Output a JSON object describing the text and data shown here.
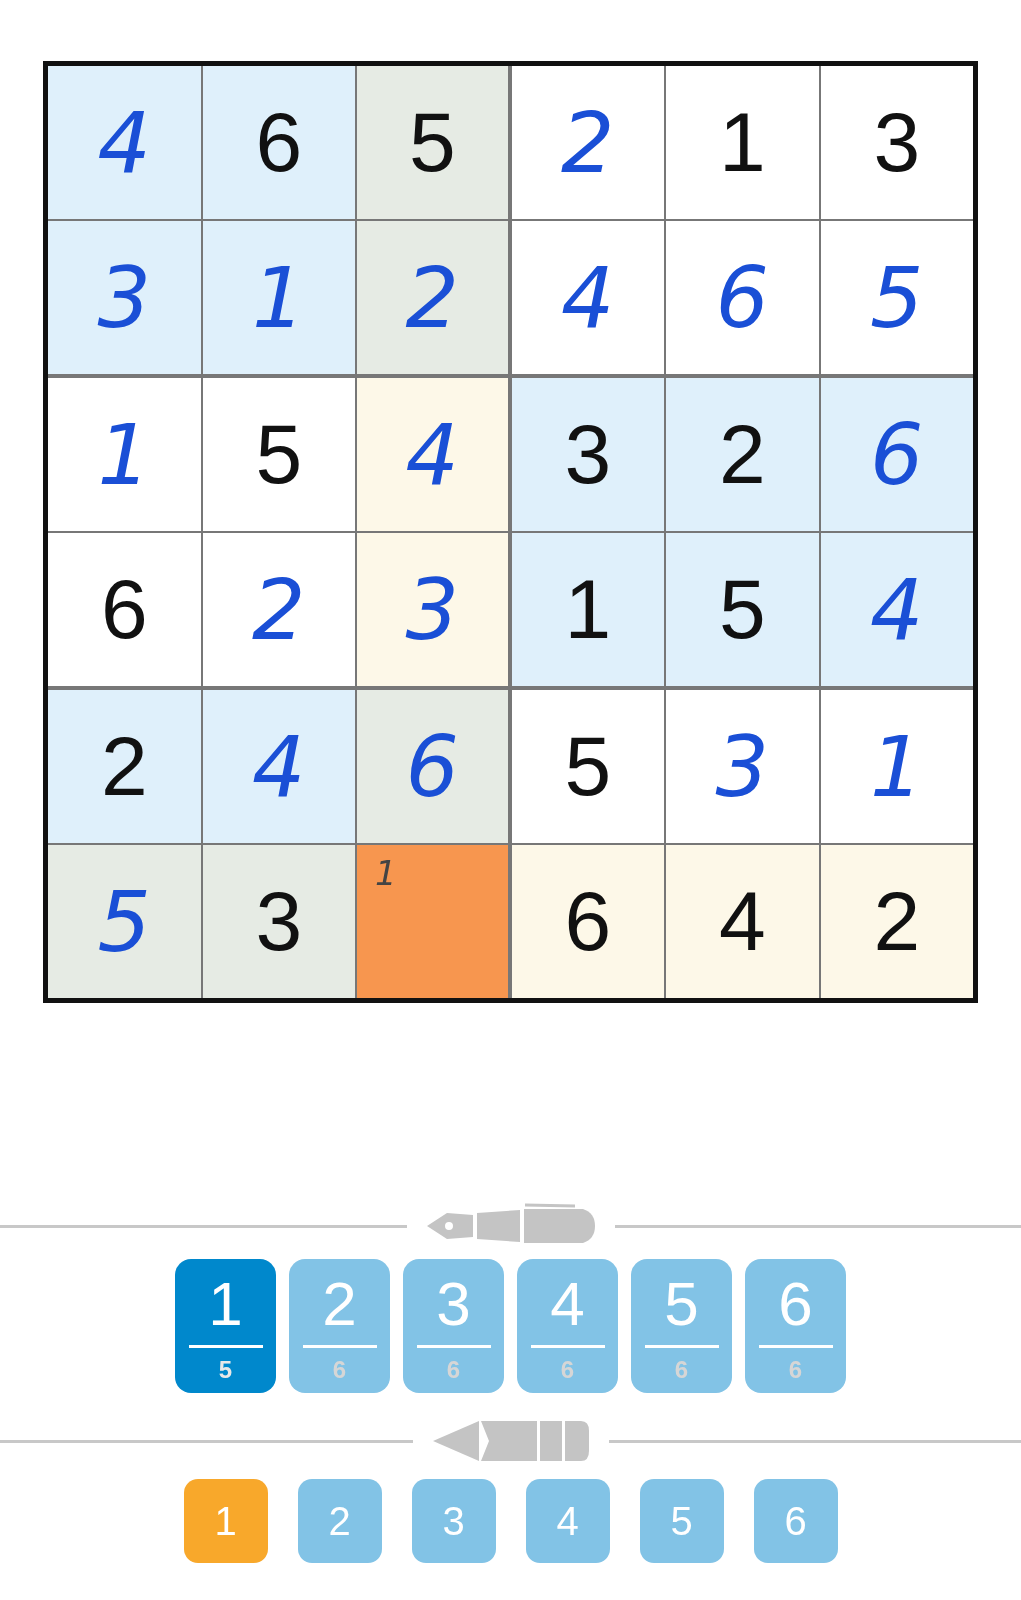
{
  "grid": [
    [
      {
        "value": "4",
        "kind": "entered",
        "color": "#dff0fb"
      },
      {
        "value": "6",
        "kind": "given",
        "color": "#dff0fb"
      },
      {
        "value": "5",
        "kind": "given",
        "color": "#e6ebe4"
      },
      {
        "value": "2",
        "kind": "entered",
        "color": "#ffffff"
      },
      {
        "value": "1",
        "kind": "given",
        "color": "#ffffff"
      },
      {
        "value": "3",
        "kind": "given",
        "color": "#ffffff"
      }
    ],
    [
      {
        "value": "3",
        "kind": "entered",
        "color": "#dff0fb"
      },
      {
        "value": "1",
        "kind": "entered",
        "color": "#dff0fb"
      },
      {
        "value": "2",
        "kind": "entered",
        "color": "#e6ebe4"
      },
      {
        "value": "4",
        "kind": "entered",
        "color": "#ffffff"
      },
      {
        "value": "6",
        "kind": "entered",
        "color": "#ffffff"
      },
      {
        "value": "5",
        "kind": "entered",
        "color": "#ffffff"
      }
    ],
    [
      {
        "value": "1",
        "kind": "entered",
        "color": "#ffffff"
      },
      {
        "value": "5",
        "kind": "given",
        "color": "#ffffff"
      },
      {
        "value": "4",
        "kind": "entered",
        "color": "#fdf8e8"
      },
      {
        "value": "3",
        "kind": "given",
        "color": "#dff0fb"
      },
      {
        "value": "2",
        "kind": "given",
        "color": "#dff0fb"
      },
      {
        "value": "6",
        "kind": "entered",
        "color": "#dff0fb"
      }
    ],
    [
      {
        "value": "6",
        "kind": "given",
        "color": "#ffffff"
      },
      {
        "value": "2",
        "kind": "entered",
        "color": "#ffffff"
      },
      {
        "value": "3",
        "kind": "entered",
        "color": "#fdf8e8"
      },
      {
        "value": "1",
        "kind": "given",
        "color": "#dff0fb"
      },
      {
        "value": "5",
        "kind": "given",
        "color": "#dff0fb"
      },
      {
        "value": "4",
        "kind": "entered",
        "color": "#dff0fb"
      }
    ],
    [
      {
        "value": "2",
        "kind": "given",
        "color": "#dff0fb"
      },
      {
        "value": "4",
        "kind": "entered",
        "color": "#dff0fb"
      },
      {
        "value": "6",
        "kind": "entered",
        "color": "#e6ebe4"
      },
      {
        "value": "5",
        "kind": "given",
        "color": "#ffffff"
      },
      {
        "value": "3",
        "kind": "entered",
        "color": "#ffffff"
      },
      {
        "value": "1",
        "kind": "entered",
        "color": "#ffffff"
      }
    ],
    [
      {
        "value": "5",
        "kind": "entered",
        "color": "#e6ebe4"
      },
      {
        "value": "3",
        "kind": "given",
        "color": "#e6ebe4"
      },
      {
        "kind": "notes",
        "notes": "1",
        "selected": true
      },
      {
        "value": "6",
        "kind": "given",
        "color": "#fdf8e8"
      },
      {
        "value": "4",
        "kind": "given",
        "color": "#fdf8e8"
      },
      {
        "value": "2",
        "kind": "given",
        "color": "#fdf8e8"
      }
    ]
  ],
  "pen_buttons": [
    {
      "digit": "1",
      "count": "5",
      "selected": true
    },
    {
      "digit": "2",
      "count": "6",
      "selected": false
    },
    {
      "digit": "3",
      "count": "6",
      "selected": false
    },
    {
      "digit": "4",
      "count": "6",
      "selected": false
    },
    {
      "digit": "5",
      "count": "6",
      "selected": false
    },
    {
      "digit": "6",
      "count": "6",
      "selected": false
    }
  ],
  "pencil_buttons": [
    {
      "digit": "1",
      "selected": true
    },
    {
      "digit": "2",
      "selected": false
    },
    {
      "digit": "3",
      "selected": false
    },
    {
      "digit": "4",
      "selected": false
    },
    {
      "digit": "5",
      "selected": false
    },
    {
      "digit": "6",
      "selected": false
    }
  ]
}
